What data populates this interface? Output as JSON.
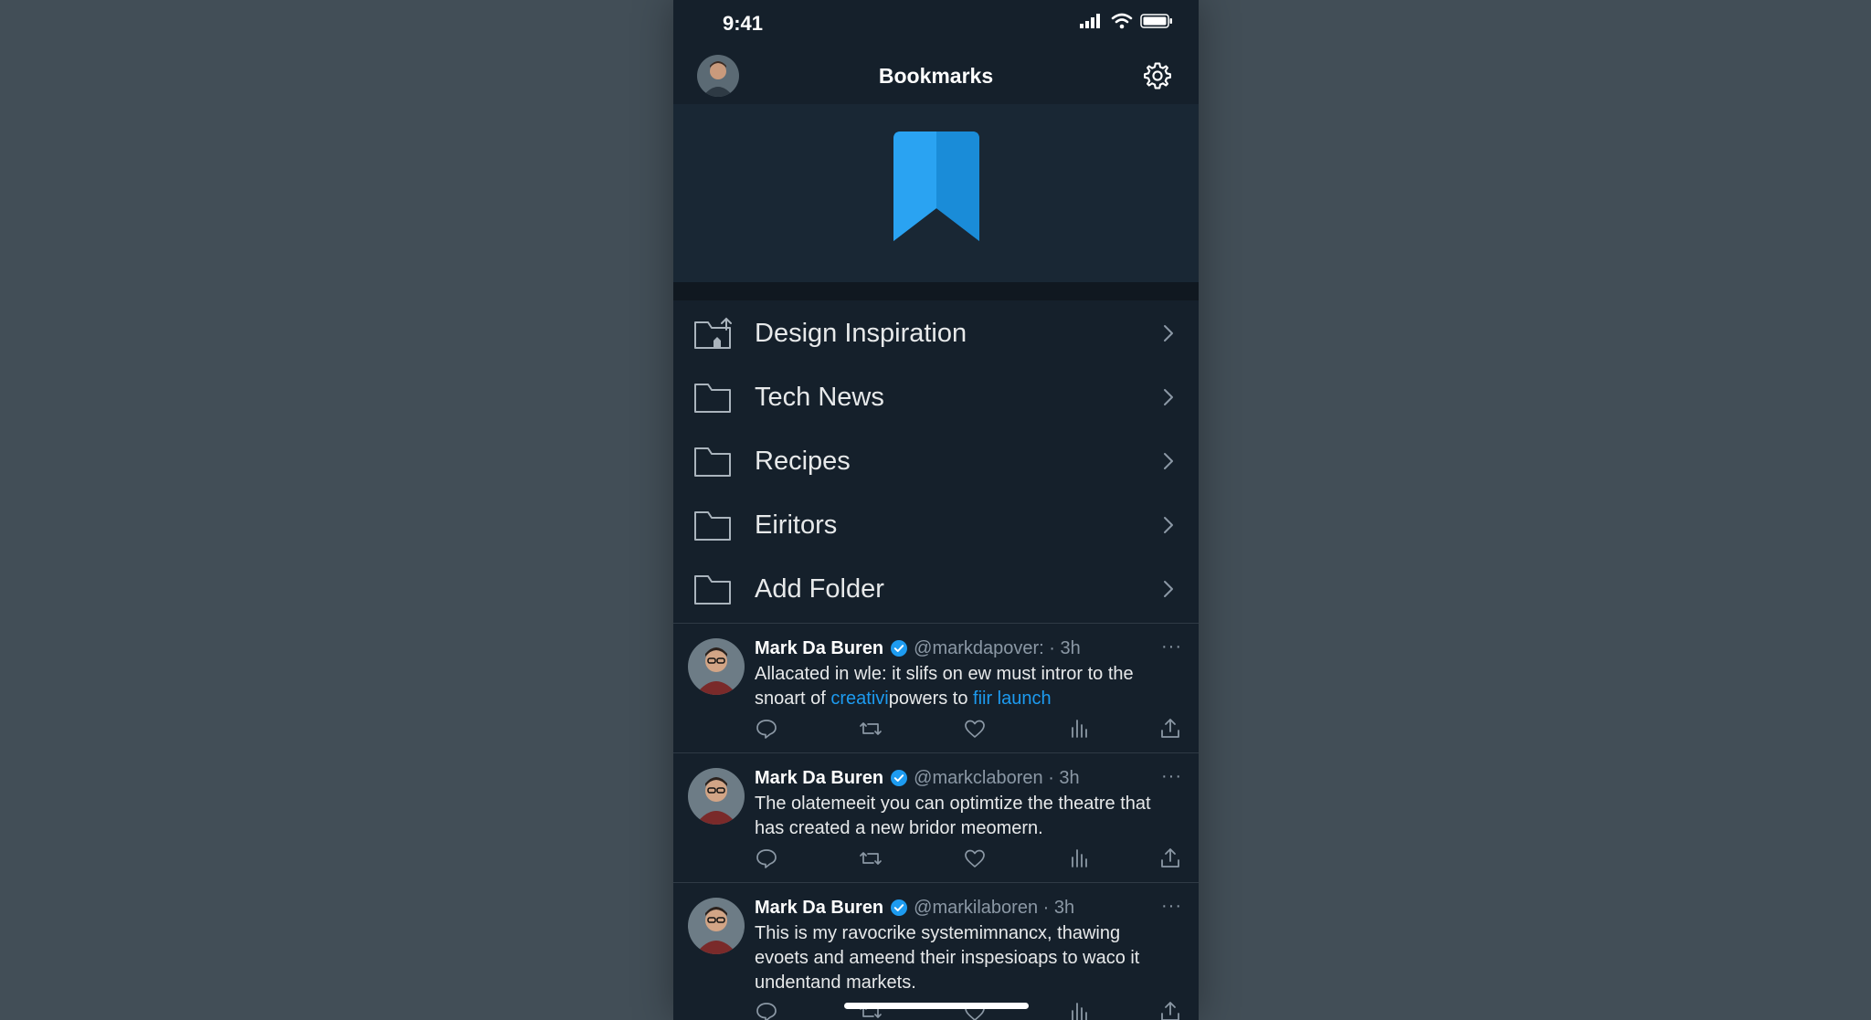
{
  "status_bar": {
    "time": "9:41",
    "icons": [
      "signal-icon",
      "wifi-icon",
      "battery-icon"
    ]
  },
  "header": {
    "title": "Bookmarks",
    "settings_icon": "gear-icon"
  },
  "hero": {
    "icon": "bookmark-icon",
    "color": "#1d9bf0"
  },
  "folders": [
    {
      "label": "Design Inspiration",
      "icon": "folder-upload-icon"
    },
    {
      "label": "Tech News",
      "icon": "folder-icon"
    },
    {
      "label": "Recipes",
      "icon": "folder-icon"
    },
    {
      "label": "Eiritors",
      "icon": "folder-icon"
    },
    {
      "label": "Add Folder",
      "icon": "folder-icon"
    }
  ],
  "tweets": [
    {
      "name": "Mark Da Buren",
      "handle": "@markdapover:",
      "time": "· 3h",
      "text_parts": [
        "Allacated in wle: it slifs on ew must intror to the snoart of ",
        "creativi",
        "powers to ",
        "fiir launch"
      ]
    },
    {
      "name": "Mark Da Buren",
      "handle": "@markclaboren",
      "time": "· 3h",
      "text": "The olatemeeit you can optimtize the theatre that has created a new bridor meomern."
    },
    {
      "name": "Mark Da Buren",
      "handle": "@markilaboren",
      "time": "· 3h",
      "text": "This is my ravocrike systemimnancx, thawing evoets and ameend their inspesioaps to waco it undentand markets."
    }
  ],
  "tweet_actions": [
    "reply-icon",
    "retweet-icon",
    "like-icon",
    "views-icon",
    "share-icon"
  ],
  "more_label": "···",
  "colors": {
    "background": "#15202b",
    "accent": "#1d9bf0",
    "muted": "#8b98a5",
    "outer": "#424e57"
  }
}
